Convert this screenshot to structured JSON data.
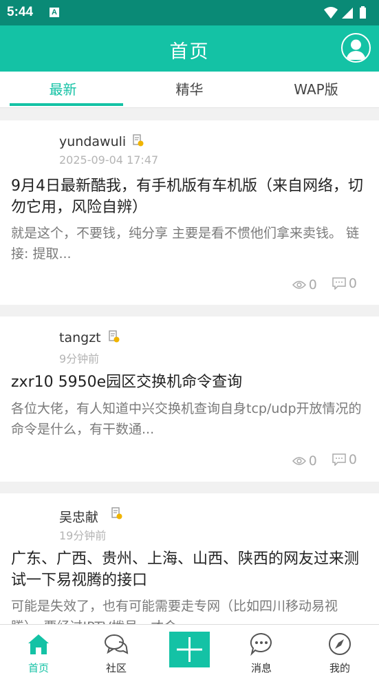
{
  "status_bar": {
    "time": "5:44",
    "notification_icon": "A"
  },
  "app_bar": {
    "title": "首页"
  },
  "tabs": [
    {
      "label": "最新",
      "active": true
    },
    {
      "label": "精华",
      "active": false
    },
    {
      "label": "WAP版",
      "active": false
    }
  ],
  "posts": [
    {
      "author": "yundawuli",
      "time": "2025-09-04 17:47",
      "title": "9月4日最新酷我，有手机版有车机版（来自网络，切勿它用，风险自辨）",
      "excerpt": "就是这个，不要钱，纯分享  主要是看不惯他们拿来卖钱。   链接:  提取...",
      "views": "0",
      "comments": "0"
    },
    {
      "author": "tangzt",
      "time": "9分钟前",
      "title": "zxr10 5950e园区交换机命令查询",
      "excerpt": "各位大佬，有人知道中兴交换机查询自身tcp/udp开放情况的命令是什么，有干数通...",
      "views": "0",
      "comments": "0"
    },
    {
      "author": "吴忠献",
      "time": "19分钟前",
      "title": "广东、广西、贵州、上海、山西、陕西的网友过来测试一下易视腾的接口",
      "excerpt": "可能是失效了，也有可能需要走专网（比如四川移动易视腾），要经过IPTV拨号，才会",
      "views": "",
      "comments": ""
    }
  ],
  "bottom_nav": [
    {
      "label": "首页",
      "icon": "home-icon",
      "active": true
    },
    {
      "label": "社区",
      "icon": "community-chat-icon",
      "active": false
    },
    {
      "label": "",
      "icon": "plus-icon",
      "active": false
    },
    {
      "label": "消息",
      "icon": "message-icon",
      "active": false
    },
    {
      "label": "我的",
      "icon": "compass-icon",
      "active": false
    }
  ],
  "colors": {
    "accent": "#14c2a5",
    "status_bar": "#0a8a76"
  }
}
